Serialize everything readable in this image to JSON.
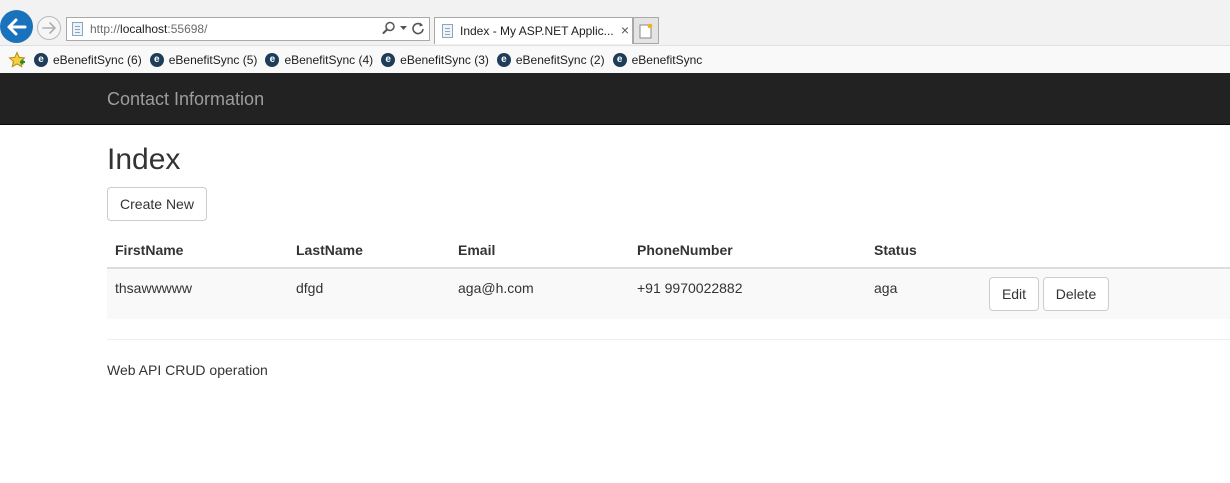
{
  "browser": {
    "url_prefix": "http://",
    "url_host": "localhost",
    "url_rest": ":55698/",
    "tab_title": "Index - My ASP.NET Applic...",
    "tab_close": "×",
    "favorites": [
      {
        "label": "eBenefitSync (6)"
      },
      {
        "label": "eBenefitSync (5)"
      },
      {
        "label": "eBenefitSync (4)"
      },
      {
        "label": "eBenefitSync (3)"
      },
      {
        "label": "eBenefitSync (2)"
      },
      {
        "label": "eBenefitSync"
      }
    ]
  },
  "navbar": {
    "brand": "Contact Information"
  },
  "page": {
    "title": "Index",
    "create_label": "Create New",
    "columns": [
      "FirstName",
      "LastName",
      "Email",
      "PhoneNumber",
      "Status"
    ],
    "rows": [
      {
        "first_name": "thsawwwww",
        "last_name": "dfgd",
        "email": "aga@h.com",
        "phone": "+91 9970022882",
        "status": "aga",
        "edit_label": "Edit",
        "delete_label": "Delete"
      }
    ],
    "footer": "Web API CRUD operation"
  },
  "colors": {
    "navbar_bg": "#222222",
    "brand_text": "#9d9d9d",
    "back_button": "#1a72bd",
    "text": "#333333"
  }
}
